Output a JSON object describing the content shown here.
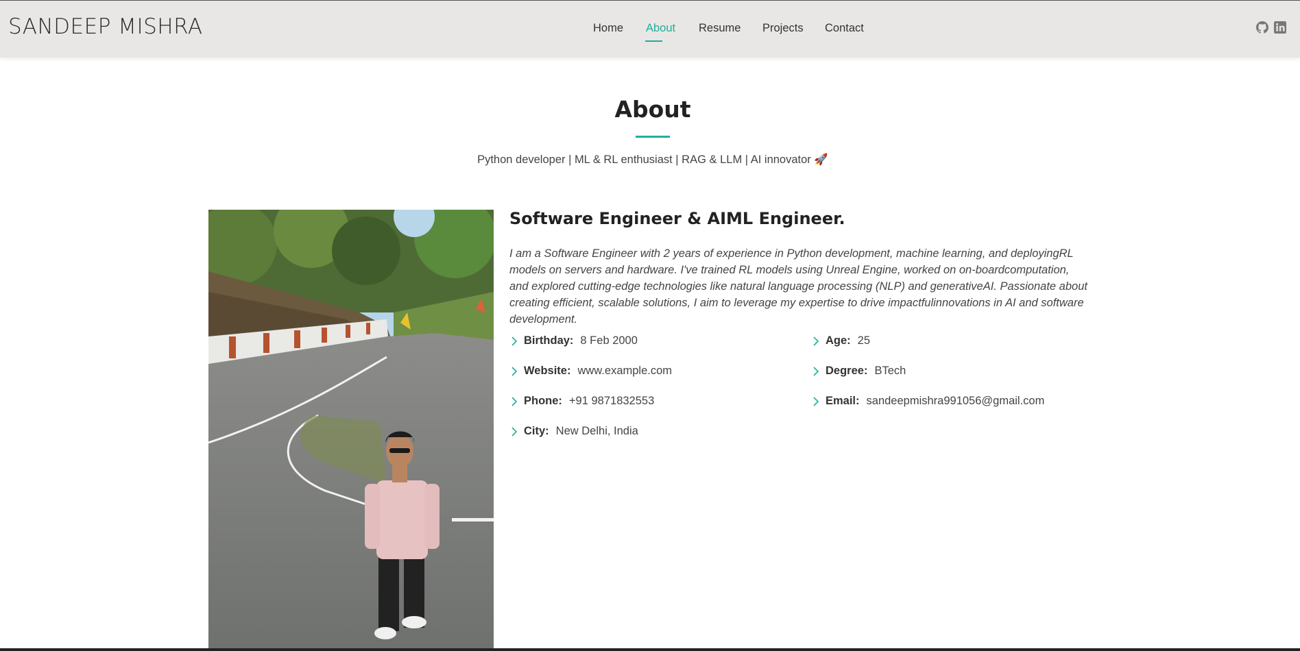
{
  "header": {
    "brand": "SANDEEP MISHRA",
    "nav": [
      {
        "label": "Home"
      },
      {
        "label": "About"
      },
      {
        "label": "Resume"
      },
      {
        "label": "Projects"
      },
      {
        "label": "Contact"
      }
    ],
    "active_nav": "About",
    "social": [
      {
        "icon": "github-icon"
      },
      {
        "icon": "linkedin-icon"
      }
    ]
  },
  "section": {
    "title": "About",
    "subtitle": "Python developer | ML & RL enthusiast | RAG & LLM | AI innovator 🚀"
  },
  "about": {
    "heading": "Software Engineer & AIML Engineer.",
    "bio": "I am a Software Engineer with 2 years of experience in Python development, machine learning, and deployingRL models on servers and hardware. I've trained RL models using Unreal Engine, worked on on-boardcomputation, and explored cutting-edge technologies like natural language processing (NLP) and generativeAI. Passionate about creating efficient, scalable solutions, I aim to leverage my expertise to drive impactfulinnovations in AI and software development.",
    "left_info": [
      {
        "label": "Birthday:",
        "value": "8 Feb 2000"
      },
      {
        "label": "Website:",
        "value": "www.example.com"
      },
      {
        "label": "Phone:",
        "value": "+91 9871832553"
      },
      {
        "label": "City:",
        "value": "New Delhi, India"
      }
    ],
    "right_info": [
      {
        "label": "Age:",
        "value": "25"
      },
      {
        "label": "Degree:",
        "value": "BTech"
      },
      {
        "label": "Email:",
        "value": "sandeepmishra991056@gmail.com"
      }
    ]
  },
  "colors": {
    "accent": "#1eaf9c",
    "header_bg": "#e8e7e5"
  }
}
